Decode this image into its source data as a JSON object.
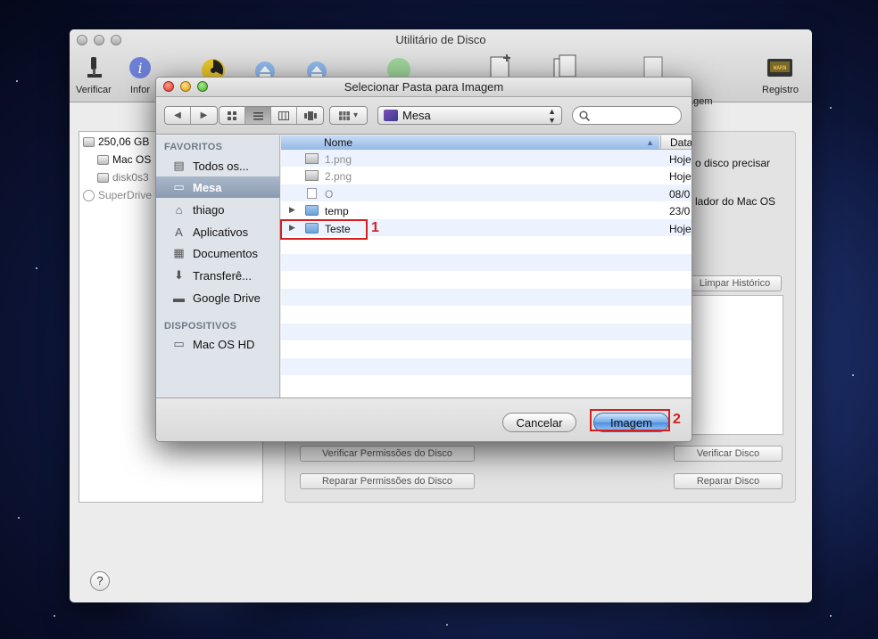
{
  "main_window": {
    "title": "Utilitário de Disco",
    "toolbar": [
      {
        "label": "Verificar",
        "icon": "microscope-icon"
      },
      {
        "label": "Infor",
        "icon": "info-icon"
      },
      {
        "label": "Registro",
        "icon": "log-icon"
      },
      {
        "label": "agem",
        "icon": "new-image-icon"
      }
    ],
    "disks": [
      "250,06 GB",
      "Mac OS",
      "disk0s3",
      "SuperDrive"
    ],
    "right_text": [
      "o disco precisar",
      "lador do Mac OS"
    ],
    "buttons": {
      "clear_history": "Limpar Histórico",
      "verify_permissions": "Verificar Permissões do Disco",
      "repair_permissions": "Reparar Permissões do Disco",
      "verify_disk": "Verificar Disco",
      "repair_disk": "Reparar Disco",
      "help": "?"
    }
  },
  "dialog": {
    "title": "Selecionar Pasta para Imagem",
    "toolbar": {
      "back": "◀",
      "forward": "▶",
      "view_buttons": [
        "icon-view",
        "list-view",
        "column-view",
        "coverflow-view"
      ],
      "arrange": "▾",
      "path_popup": "Mesa",
      "search_placeholder": ""
    },
    "sidebar": {
      "favorites_header": "FAVORITOS",
      "favorites": [
        {
          "label": "Todos os...",
          "icon": "all-files-icon",
          "glyph": "▤"
        },
        {
          "label": "Mesa",
          "icon": "desktop-icon",
          "glyph": "▭",
          "selected": true
        },
        {
          "label": "thiago",
          "icon": "home-icon",
          "glyph": "⌂"
        },
        {
          "label": "Aplicativos",
          "icon": "applications-icon",
          "glyph": "A"
        },
        {
          "label": "Documentos",
          "icon": "documents-icon",
          "glyph": "▦"
        },
        {
          "label": "Transferê...",
          "icon": "downloads-icon",
          "glyph": "⬇"
        },
        {
          "label": "Google Drive",
          "icon": "folder-icon",
          "glyph": "▬"
        }
      ],
      "devices_header": "DISPOSITIVOS",
      "devices": [
        {
          "label": "Mac OS HD",
          "icon": "hard-drive-icon",
          "glyph": "▭"
        }
      ]
    },
    "columns": {
      "name": "Nome",
      "date": "Data"
    },
    "files": [
      {
        "name": "1.png",
        "date": "Hoje",
        "kind": "image",
        "dim": true
      },
      {
        "name": "2.png",
        "date": "Hoje",
        "kind": "image",
        "dim": true
      },
      {
        "name": "O",
        "date": "08/0",
        "kind": "doc",
        "dim": true
      },
      {
        "name": "temp",
        "date": "23/0",
        "kind": "folder",
        "dim": false
      },
      {
        "name": "Teste",
        "date": "Hoje",
        "kind": "folder",
        "dim": false
      }
    ],
    "buttons": {
      "cancel": "Cancelar",
      "confirm": "Imagem"
    }
  },
  "annotations": {
    "step1": "1",
    "step2": "2"
  },
  "colors": {
    "annotation_red": "#d51f1f",
    "selection": "#8a9bb2",
    "default_button": "#4d8ee0"
  }
}
